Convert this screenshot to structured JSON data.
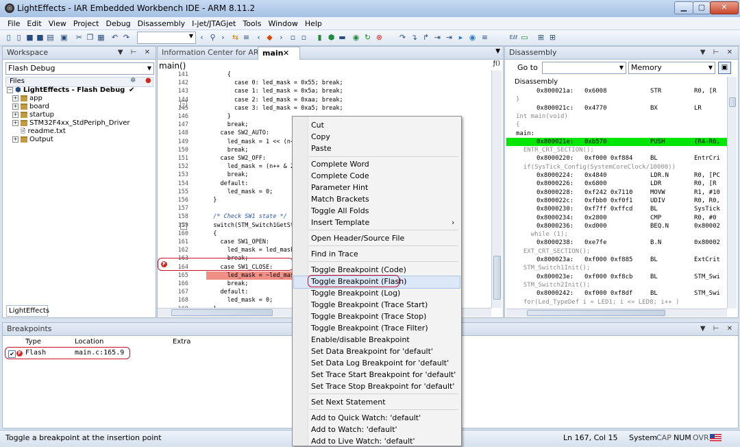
{
  "window": {
    "title": "LightEffects - IAR Embedded Workbench IDE - ARM 8.11.2",
    "min": "▁",
    "max": "▢",
    "close": "✕"
  },
  "menu": [
    "File",
    "Edit",
    "View",
    "Project",
    "Debug",
    "Disassembly",
    "I-jet/JTAGjet",
    "Tools",
    "Window",
    "Help"
  ],
  "workspace": {
    "title": "Workspace",
    "config": "Flash Debug",
    "files_header": "Files",
    "tree": [
      {
        "label": "LightEffects - Flash Debug",
        "check": "✔",
        "level": 0
      },
      {
        "label": "app",
        "level": 1
      },
      {
        "label": "board",
        "level": 1
      },
      {
        "label": "startup",
        "level": 1
      },
      {
        "label": "STM32F4xx_StdPeriph_Driver",
        "level": 1
      },
      {
        "label": "readme.txt",
        "level": 1,
        "file": true
      },
      {
        "label": "Output",
        "level": 1
      }
    ],
    "bottom_tab": "LightEffects"
  },
  "editor": {
    "tabs": [
      "Information Center for ARM",
      "main"
    ],
    "function": "main()",
    "lines": [
      {
        "n": "141",
        "c": "      {"
      },
      {
        "n": "142",
        "c": "        case 0: led_mask = 0x55; break;"
      },
      {
        "n": "143",
        "c": "        case 1: led_mask = 0x5a; break;"
      },
      {
        "n": "144",
        "c": "        case 2: led_mask = 0xaa; break;"
      },
      {
        "n": "145",
        "c": "        case 3: led_mask = 0xa5; break;"
      },
      {
        "n": "146",
        "c": "      }"
      },
      {
        "n": "147",
        "c": "      break;"
      },
      {
        "n": "148",
        "c": "    case SW2_AUTO:"
      },
      {
        "n": "149",
        "c": "      led_mask = 1 << (n++ %"
      },
      {
        "n": "150",
        "c": "      break;"
      },
      {
        "n": "151",
        "c": "    case SW2_OFF:"
      },
      {
        "n": "152",
        "c": "      led_mask = (n++ & 2)?"
      },
      {
        "n": "153",
        "c": "      break;"
      },
      {
        "n": "154",
        "c": "    default:"
      },
      {
        "n": "155",
        "c": "      led_mask = 0;"
      },
      {
        "n": "156",
        "c": "  }"
      },
      {
        "n": "157",
        "c": ""
      },
      {
        "n": "158",
        "c": "  /* Check SW1 state */"
      },
      {
        "n": "159",
        "c": "  switch(STM_Switch1GetState"
      },
      {
        "n": "160",
        "c": "  {"
      },
      {
        "n": "161",
        "c": "    case SW1_OPEN:"
      },
      {
        "n": "162",
        "c": "      led_mask = led_mask;"
      },
      {
        "n": "163",
        "c": "      break;"
      },
      {
        "n": "164",
        "c": "    case SW1_CLOSE:"
      },
      {
        "n": "165",
        "c": "      led_mask = ~led_mask;"
      },
      {
        "n": "166",
        "c": "      break;"
      },
      {
        "n": "167",
        "c": "    default:"
      },
      {
        "n": "168",
        "c": "      led_mask = 0;"
      },
      {
        "n": "169",
        "c": "  }"
      },
      {
        "n": "170",
        "c": ""
      }
    ]
  },
  "context_menu": {
    "items": [
      "Cut",
      "Copy",
      "Paste",
      "Complete Word",
      "Complete Code",
      "Parameter Hint",
      "Match Brackets",
      "Toggle All Folds",
      "Insert Template",
      "Open Header/Source File",
      "Find in Trace",
      "Toggle Breakpoint (Code)",
      "Toggle Breakpoint (Flash)",
      "Toggle Breakpoint (Log)",
      "Toggle Breakpoint (Trace Start)",
      "Toggle Breakpoint (Trace Stop)",
      "Toggle Breakpoint (Trace Filter)",
      "Enable/disable Breakpoint",
      "Set Data Breakpoint for 'default'",
      "Set Data Log Breakpoint for 'default'",
      "Set Trace Start Breakpoint for 'default'",
      "Set Trace Stop Breakpoint for 'default'",
      "Set Next Statement",
      "Add to Quick Watch:  'default'",
      "Add to Watch: 'default'",
      "Add to Live Watch: 'default'"
    ],
    "submenu_arrow": "›"
  },
  "disassembly": {
    "title": "Disassembly",
    "goto_label": "Go to",
    "memory": "Memory",
    "header": "Disassembly",
    "lines": [
      {
        "t": "code",
        "a": "0x800021a:",
        "h": "0x6008",
        "m": "STR",
        "o": "R0, [R"
      },
      {
        "t": "src",
        "s": "}"
      },
      {
        "t": "code",
        "a": "0x800021c:",
        "h": "0x4770",
        "m": "BX",
        "o": "LR"
      },
      {
        "t": "src",
        "s": "int main(void)"
      },
      {
        "t": "src",
        "s": "{"
      },
      {
        "t": "label",
        "s": "main:"
      },
      {
        "t": "hl",
        "a": "0x800021e:",
        "h": "0xb570",
        "m": "PUSH",
        "o": "{R4-R6,"
      },
      {
        "t": "src",
        "s": "  ENTR_CRT_SECTION();"
      },
      {
        "t": "code",
        "a": "0x8000220:",
        "h": "0xf000 0xf884",
        "m": "BL",
        "o": "EntrCri"
      },
      {
        "t": "src",
        "s": "  if(SysTick_Config(SystemCoreClock/10000))"
      },
      {
        "t": "code",
        "a": "0x8000224:",
        "h": "0x4840",
        "m": "LDR.N",
        "o": "R0, [PC"
      },
      {
        "t": "code",
        "a": "0x8000226:",
        "h": "0x6800",
        "m": "LDR",
        "o": "R0, [R"
      },
      {
        "t": "code",
        "a": "0x8000228:",
        "h": "0xf242 0x7110",
        "m": "MOVW",
        "o": "R1, #10"
      },
      {
        "t": "code",
        "a": "0x800022c:",
        "h": "0xfbb0 0xf0f1",
        "m": "UDIV",
        "o": "R0, R0,"
      },
      {
        "t": "code",
        "a": "0x8000230:",
        "h": "0xf7ff 0xffcd",
        "m": "BL",
        "o": "SysTick"
      },
      {
        "t": "code",
        "a": "0x8000234:",
        "h": "0x2800",
        "m": "CMP",
        "o": "R0, #0"
      },
      {
        "t": "code",
        "a": "0x8000236:",
        "h": "0xd000",
        "m": "BEQ.N",
        "o": "0x80002"
      },
      {
        "t": "src",
        "s": "    while (1);"
      },
      {
        "t": "code",
        "a": "0x8000238:",
        "h": "0xe7fe",
        "m": "B.N",
        "o": "0x80002"
      },
      {
        "t": "src",
        "s": "  EXT_CRT_SECTION();"
      },
      {
        "t": "code",
        "a": "0x800023a:",
        "h": "0xf000 0xf885",
        "m": "BL",
        "o": "ExtCrit"
      },
      {
        "t": "src",
        "s": "  STM_Switch1Init();"
      },
      {
        "t": "code",
        "a": "0x800023e:",
        "h": "0xf000 0xf8cb",
        "m": "BL",
        "o": "STM_Swi"
      },
      {
        "t": "src",
        "s": "  STM_Switch2Init();"
      },
      {
        "t": "code",
        "a": "0x8000242:",
        "h": "0xf000 0xf8df",
        "m": "BL",
        "o": "STM_Swi"
      },
      {
        "t": "src",
        "s": "  for(Led_TypeDef i = LED1; i <= LED8; i++ )"
      }
    ]
  },
  "breakpoints": {
    "title": "Breakpoints",
    "columns": [
      "Type",
      "Location",
      "Extra"
    ],
    "rows": [
      {
        "type": "Flash",
        "location": "main.c:165.9"
      }
    ]
  },
  "status": {
    "message": "Toggle a breakpoint at the insertion point",
    "position": "Ln 167, Col 15",
    "mode": "System",
    "caps": "CAP",
    "num": "NUM",
    "ovr": "OVR"
  },
  "colors": {
    "highlight": "#00e600",
    "breakpoint": "#d0281e",
    "annotation": "#c8102e"
  }
}
